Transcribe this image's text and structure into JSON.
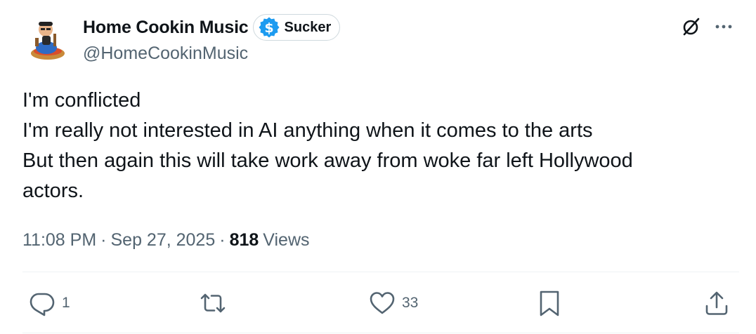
{
  "author": {
    "display_name": "Home Cookin Music",
    "handle": "@HomeCookinMusic",
    "badge_label": "Sucker",
    "badge_icon": "dollar-sign-icon",
    "badge_color": "#1d9bf0"
  },
  "tweet": {
    "lines": [
      "I'm conflicted",
      "I'm really not interested in AI anything when it comes to the arts",
      "But then again this will take work away from woke far left Hollywood",
      "actors."
    ]
  },
  "meta": {
    "time": "11:08 PM",
    "separator": "·",
    "date": "Sep 27, 2025",
    "views_count": "818",
    "views_label": "Views"
  },
  "actions": {
    "reply": {
      "icon": "reply-icon",
      "count": "1"
    },
    "retweet": {
      "icon": "retweet-icon",
      "count": ""
    },
    "like": {
      "icon": "heart-icon",
      "count": "33"
    },
    "bookmark": {
      "icon": "bookmark-icon"
    },
    "share": {
      "icon": "share-icon"
    }
  },
  "header_icons": [
    "grok-icon",
    "more-icon"
  ],
  "colors": {
    "text": "#0f1419",
    "secondary": "#536471",
    "accent": "#1d9bf0",
    "divider": "#eff3f4"
  }
}
